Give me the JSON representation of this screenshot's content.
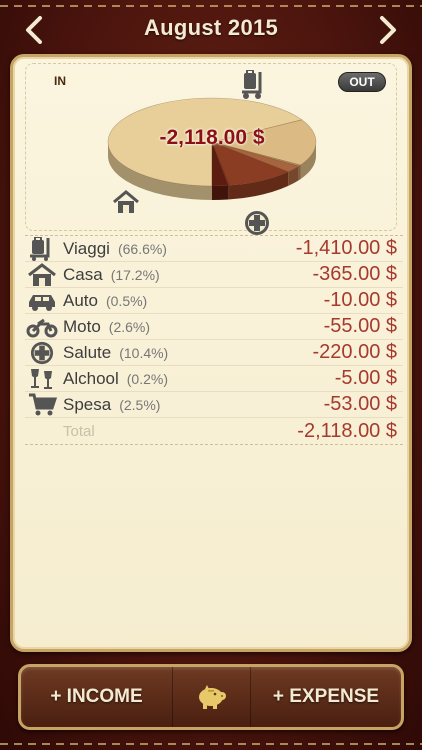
{
  "header": {
    "title": "August 2015"
  },
  "chart_area": {
    "in_label": "IN",
    "out_label": "OUT",
    "total": "-2,118.00 $"
  },
  "chart_data": {
    "type": "pie",
    "categories": [
      "Viaggi",
      "Casa",
      "Auto",
      "Moto",
      "Salute",
      "Alchool",
      "Spesa"
    ],
    "values": [
      66.6,
      17.2,
      0.5,
      2.6,
      10.4,
      0.2,
      2.5
    ],
    "colors": [
      "#e8cf99",
      "#dbbb83",
      "#b78a5e",
      "#a7653f",
      "#8a3d22",
      "#7a2a16",
      "#5c1c10"
    ]
  },
  "expenses": [
    {
      "name": "Viaggi",
      "pct": "(66.6%)",
      "amount": "-1,410.00 $",
      "icon": "luggage-cart-icon"
    },
    {
      "name": "Casa",
      "pct": "(17.2%)",
      "amount": "-365.00 $",
      "icon": "house-icon"
    },
    {
      "name": "Auto",
      "pct": "(0.5%)",
      "amount": "-10.00 $",
      "icon": "car-icon"
    },
    {
      "name": "Moto",
      "pct": "(2.6%)",
      "amount": "-55.00 $",
      "icon": "motorcycle-icon"
    },
    {
      "name": "Salute",
      "pct": "(10.4%)",
      "amount": "-220.00 $",
      "icon": "medical-cross-icon"
    },
    {
      "name": "Alchool",
      "pct": "(0.2%)",
      "amount": "-5.00 $",
      "icon": "wine-glasses-icon"
    },
    {
      "name": "Spesa",
      "pct": "(2.5%)",
      "amount": "-53.00 $",
      "icon": "shopping-cart-icon"
    }
  ],
  "total_row": {
    "label": "Total",
    "amount": "-2,118.00 $"
  },
  "footer": {
    "income_label": "+ INCOME",
    "expense_label": "+ EXPENSE",
    "piggy_icon": "piggy-bank-icon"
  }
}
